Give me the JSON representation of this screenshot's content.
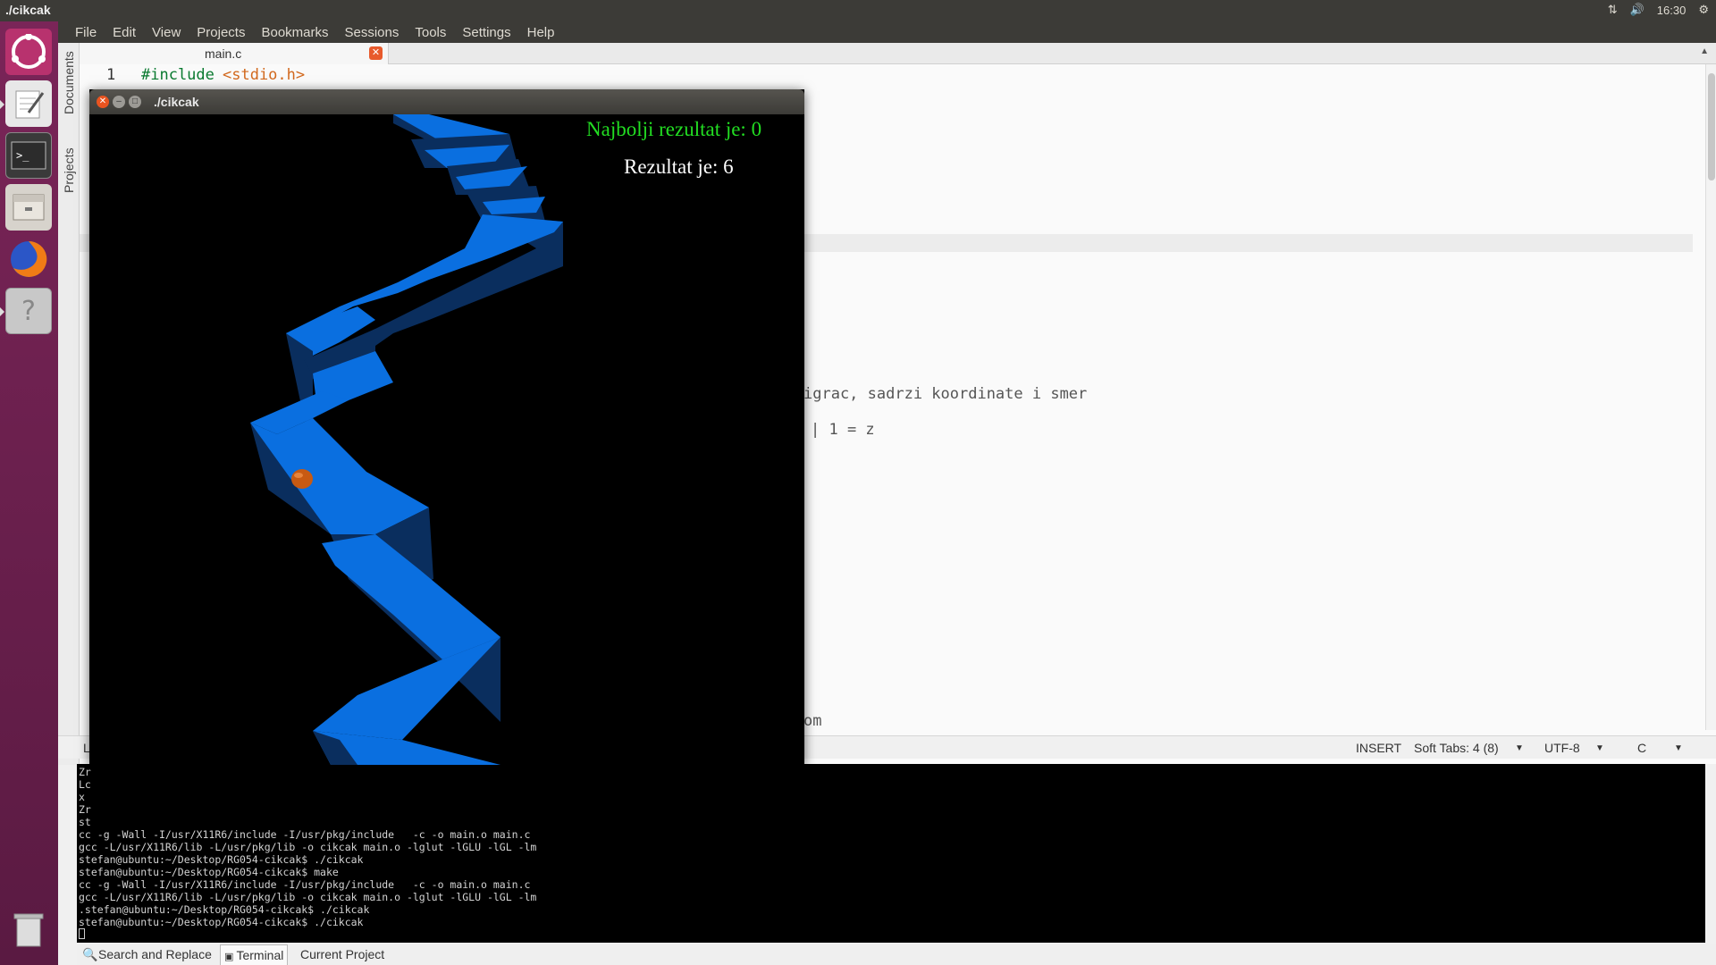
{
  "topbar": {
    "title": "./cikcak",
    "time": "16:30",
    "network_icon": "network-icon",
    "volume_icon": "volume-icon",
    "settings_icon": "gear-icon"
  },
  "launcher": {
    "items": [
      {
        "name": "ubuntu-dash",
        "icon": "ubuntu-icon"
      },
      {
        "name": "text-editor",
        "icon": "text-editor-icon"
      },
      {
        "name": "terminal",
        "icon": "terminal-icon"
      },
      {
        "name": "files",
        "icon": "files-icon"
      },
      {
        "name": "firefox",
        "icon": "firefox-icon"
      },
      {
        "name": "help",
        "icon": "help-icon"
      },
      {
        "name": "trash",
        "icon": "trash-icon"
      }
    ]
  },
  "menubar": {
    "items": [
      "File",
      "Edit",
      "View",
      "Projects",
      "Bookmarks",
      "Sessions",
      "Tools",
      "Settings",
      "Help"
    ]
  },
  "sidebar": {
    "tab_documents": "Documents",
    "tab_projects": "Projects"
  },
  "editor": {
    "tab_label": "main.c",
    "line_number": "1",
    "include_keyword": "#include",
    "include_header": "<stdio.h>",
    "fragment_1": "igrac, sadrzi koordinate i smer",
    "fragment_2": "| 1 = z",
    "fragment_3": "om"
  },
  "statusbar": {
    "left": "L",
    "mode": "INSERT",
    "tabs": "Soft Tabs: 4 (8)",
    "encoding": "UTF-8",
    "filetype": "C"
  },
  "terminal": {
    "partial_lines": [
      "Zr",
      "Lc",
      "x",
      "Zr",
      "st"
    ],
    "lines": [
      "cc -g -Wall -I/usr/X11R6/include -I/usr/pkg/include   -c -o main.o main.c",
      "gcc -L/usr/X11R6/lib -L/usr/pkg/lib -o cikcak main.o -lglut -lGLU -lGL -lm",
      "stefan@ubuntu:~/Desktop/RG054-cikcak$ ./cikcak",
      "stefan@ubuntu:~/Desktop/RG054-cikcak$ make",
      "cc -g -Wall -I/usr/X11R6/include -I/usr/pkg/include   -c -o main.o main.c",
      "gcc -L/usr/X11R6/lib -L/usr/pkg/lib -o cikcak main.o -lglut -lGLU -lGL -lm",
      ".stefan@ubuntu:~/Desktop/RG054-cikcak$ ./cikcak",
      "stefan@ubuntu:~/Desktop/RG054-cikcak$ ./cikcak"
    ]
  },
  "bottom_tabs": {
    "search": "Search and Replace",
    "terminal": "Terminal",
    "project": "Current Project"
  },
  "game": {
    "window_title": "./cikcak",
    "best_score": "Najbolji rezultat je: 0",
    "current_score": "Rezultat je: 6",
    "path_color": "#0a6fe0",
    "path_side_color": "#0a2e5e",
    "ball_color": "#c85a12"
  }
}
